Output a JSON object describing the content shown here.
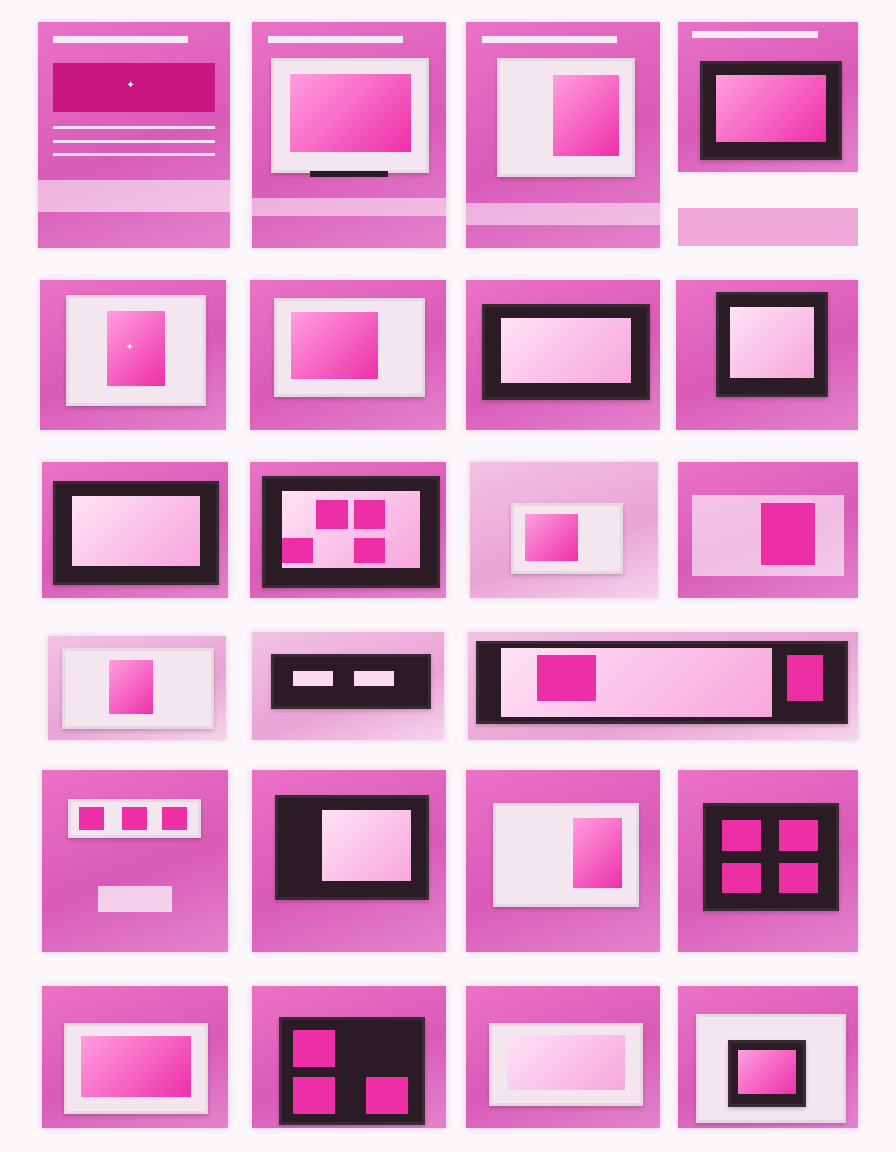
{
  "theme": {
    "accent": "#e6239d",
    "tile_color": "#de62bc",
    "light_tile_color": "#efb0dd",
    "dark_frame": "#2a1b24",
    "background": "#fbf7fa"
  },
  "tiles": [
    {
      "name": "tile-1",
      "style": "web-layout",
      "icon": "star-icon"
    },
    {
      "name": "tile-2",
      "style": "monitor"
    },
    {
      "name": "tile-3",
      "style": "monitor"
    },
    {
      "name": "tile-4",
      "style": "monitor-dark"
    },
    {
      "name": "tile-5",
      "style": "monitor",
      "icon": "star-icon"
    },
    {
      "name": "tile-6",
      "style": "monitor"
    },
    {
      "name": "tile-7",
      "style": "monitor"
    },
    {
      "name": "tile-8",
      "style": "monitor-dark"
    },
    {
      "name": "tile-9",
      "style": "monitor-dark"
    },
    {
      "name": "tile-10",
      "style": "monitor-dark"
    },
    {
      "name": "tile-11",
      "style": "monitor"
    },
    {
      "name": "tile-12",
      "style": "monitor"
    },
    {
      "name": "tile-13",
      "style": "light"
    },
    {
      "name": "tile-14",
      "style": "monitor-dark"
    },
    {
      "name": "tile-15",
      "style": "wide-dark"
    },
    {
      "name": "tile-16",
      "style": "shelf"
    },
    {
      "name": "tile-17",
      "style": "monitor-dark"
    },
    {
      "name": "tile-18",
      "style": "monitor"
    },
    {
      "name": "tile-19",
      "style": "monitor-dark"
    },
    {
      "name": "tile-20",
      "style": "monitor"
    },
    {
      "name": "tile-21",
      "style": "monitor-dark"
    },
    {
      "name": "tile-22",
      "style": "monitor-dark"
    },
    {
      "name": "tile-23",
      "style": "monitor"
    }
  ]
}
